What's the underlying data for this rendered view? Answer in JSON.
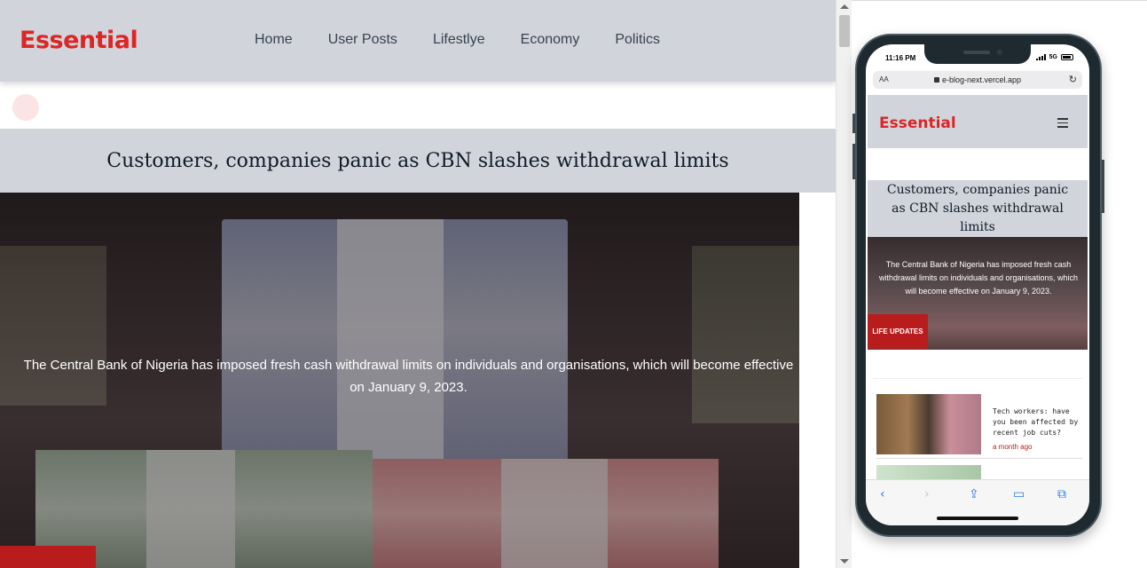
{
  "site": {
    "logo": "Essential",
    "nav": [
      "Home",
      "User Posts",
      "Lifestlye",
      "Economy",
      "Politics"
    ]
  },
  "article": {
    "title": "Customers, companies panic as CBN slashes withdrawal limits",
    "excerpt": "The Central Bank of Nigeria has imposed fresh cash withdrawal limits on individuals and organisations, which will become effective on January 9, 2023."
  },
  "phone": {
    "status_time": "11:16 PM",
    "network": "5G",
    "text_size_label": "AA",
    "url": "e-blog-next.vercel.app",
    "logo": "Essential",
    "badge": "LIFE UPDATES",
    "card": {
      "title": "Tech workers: have you been affected by recent job cuts?",
      "time": "a month ago"
    }
  },
  "colors": {
    "brand_red": "#dc2626",
    "header_gray": "#d1d5db",
    "badge_red": "#b91c1c"
  }
}
